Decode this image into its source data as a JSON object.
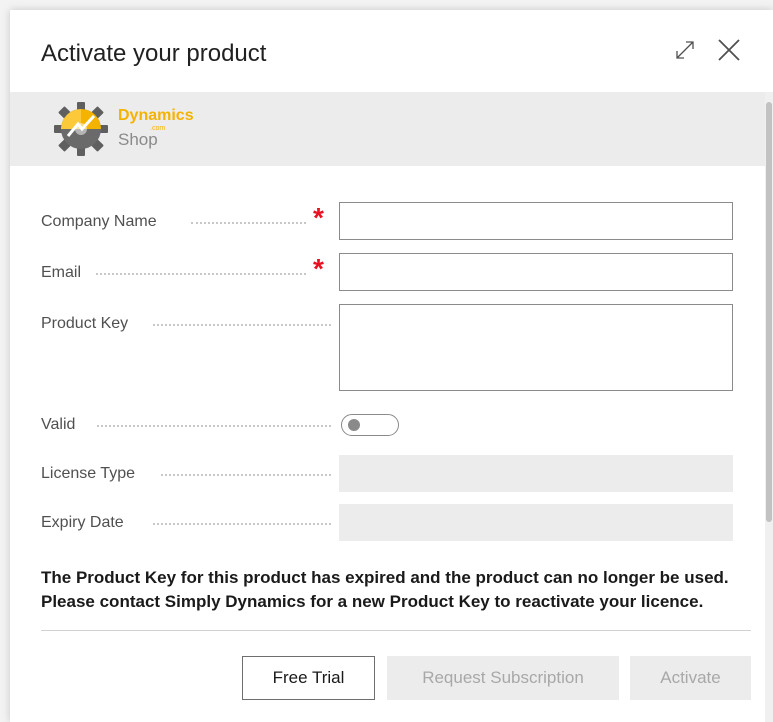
{
  "dialog": {
    "title": "Activate your product",
    "icons": {
      "expand": "expand-icon",
      "close": "close-icon"
    }
  },
  "banner": {
    "logo_icon": "gear-logo-icon",
    "brand": "Dynamics",
    "dotcom": ".com",
    "shop": "Shop"
  },
  "form": {
    "company_name": {
      "label": "Company Name",
      "value": "",
      "required": true
    },
    "email": {
      "label": "Email",
      "value": "",
      "required": true
    },
    "product_key": {
      "label": "Product Key",
      "value": ""
    },
    "valid": {
      "label": "Valid",
      "checked": false
    },
    "license_type": {
      "label": "License Type",
      "value": ""
    },
    "expiry_date": {
      "label": "Expiry Date",
      "value": ""
    },
    "required_marker": "*"
  },
  "message": "The Product Key for this product has expired and the product can no longer be used. Please contact Simply Dynamics for a new Product Key to reactivate your licence.",
  "buttons": {
    "free_trial": "Free Trial",
    "request_subscription": "Request Subscription",
    "activate": "Activate"
  },
  "colors": {
    "required": "#e81123",
    "brand": "#f5b301",
    "disabled_bg": "#ececec"
  }
}
